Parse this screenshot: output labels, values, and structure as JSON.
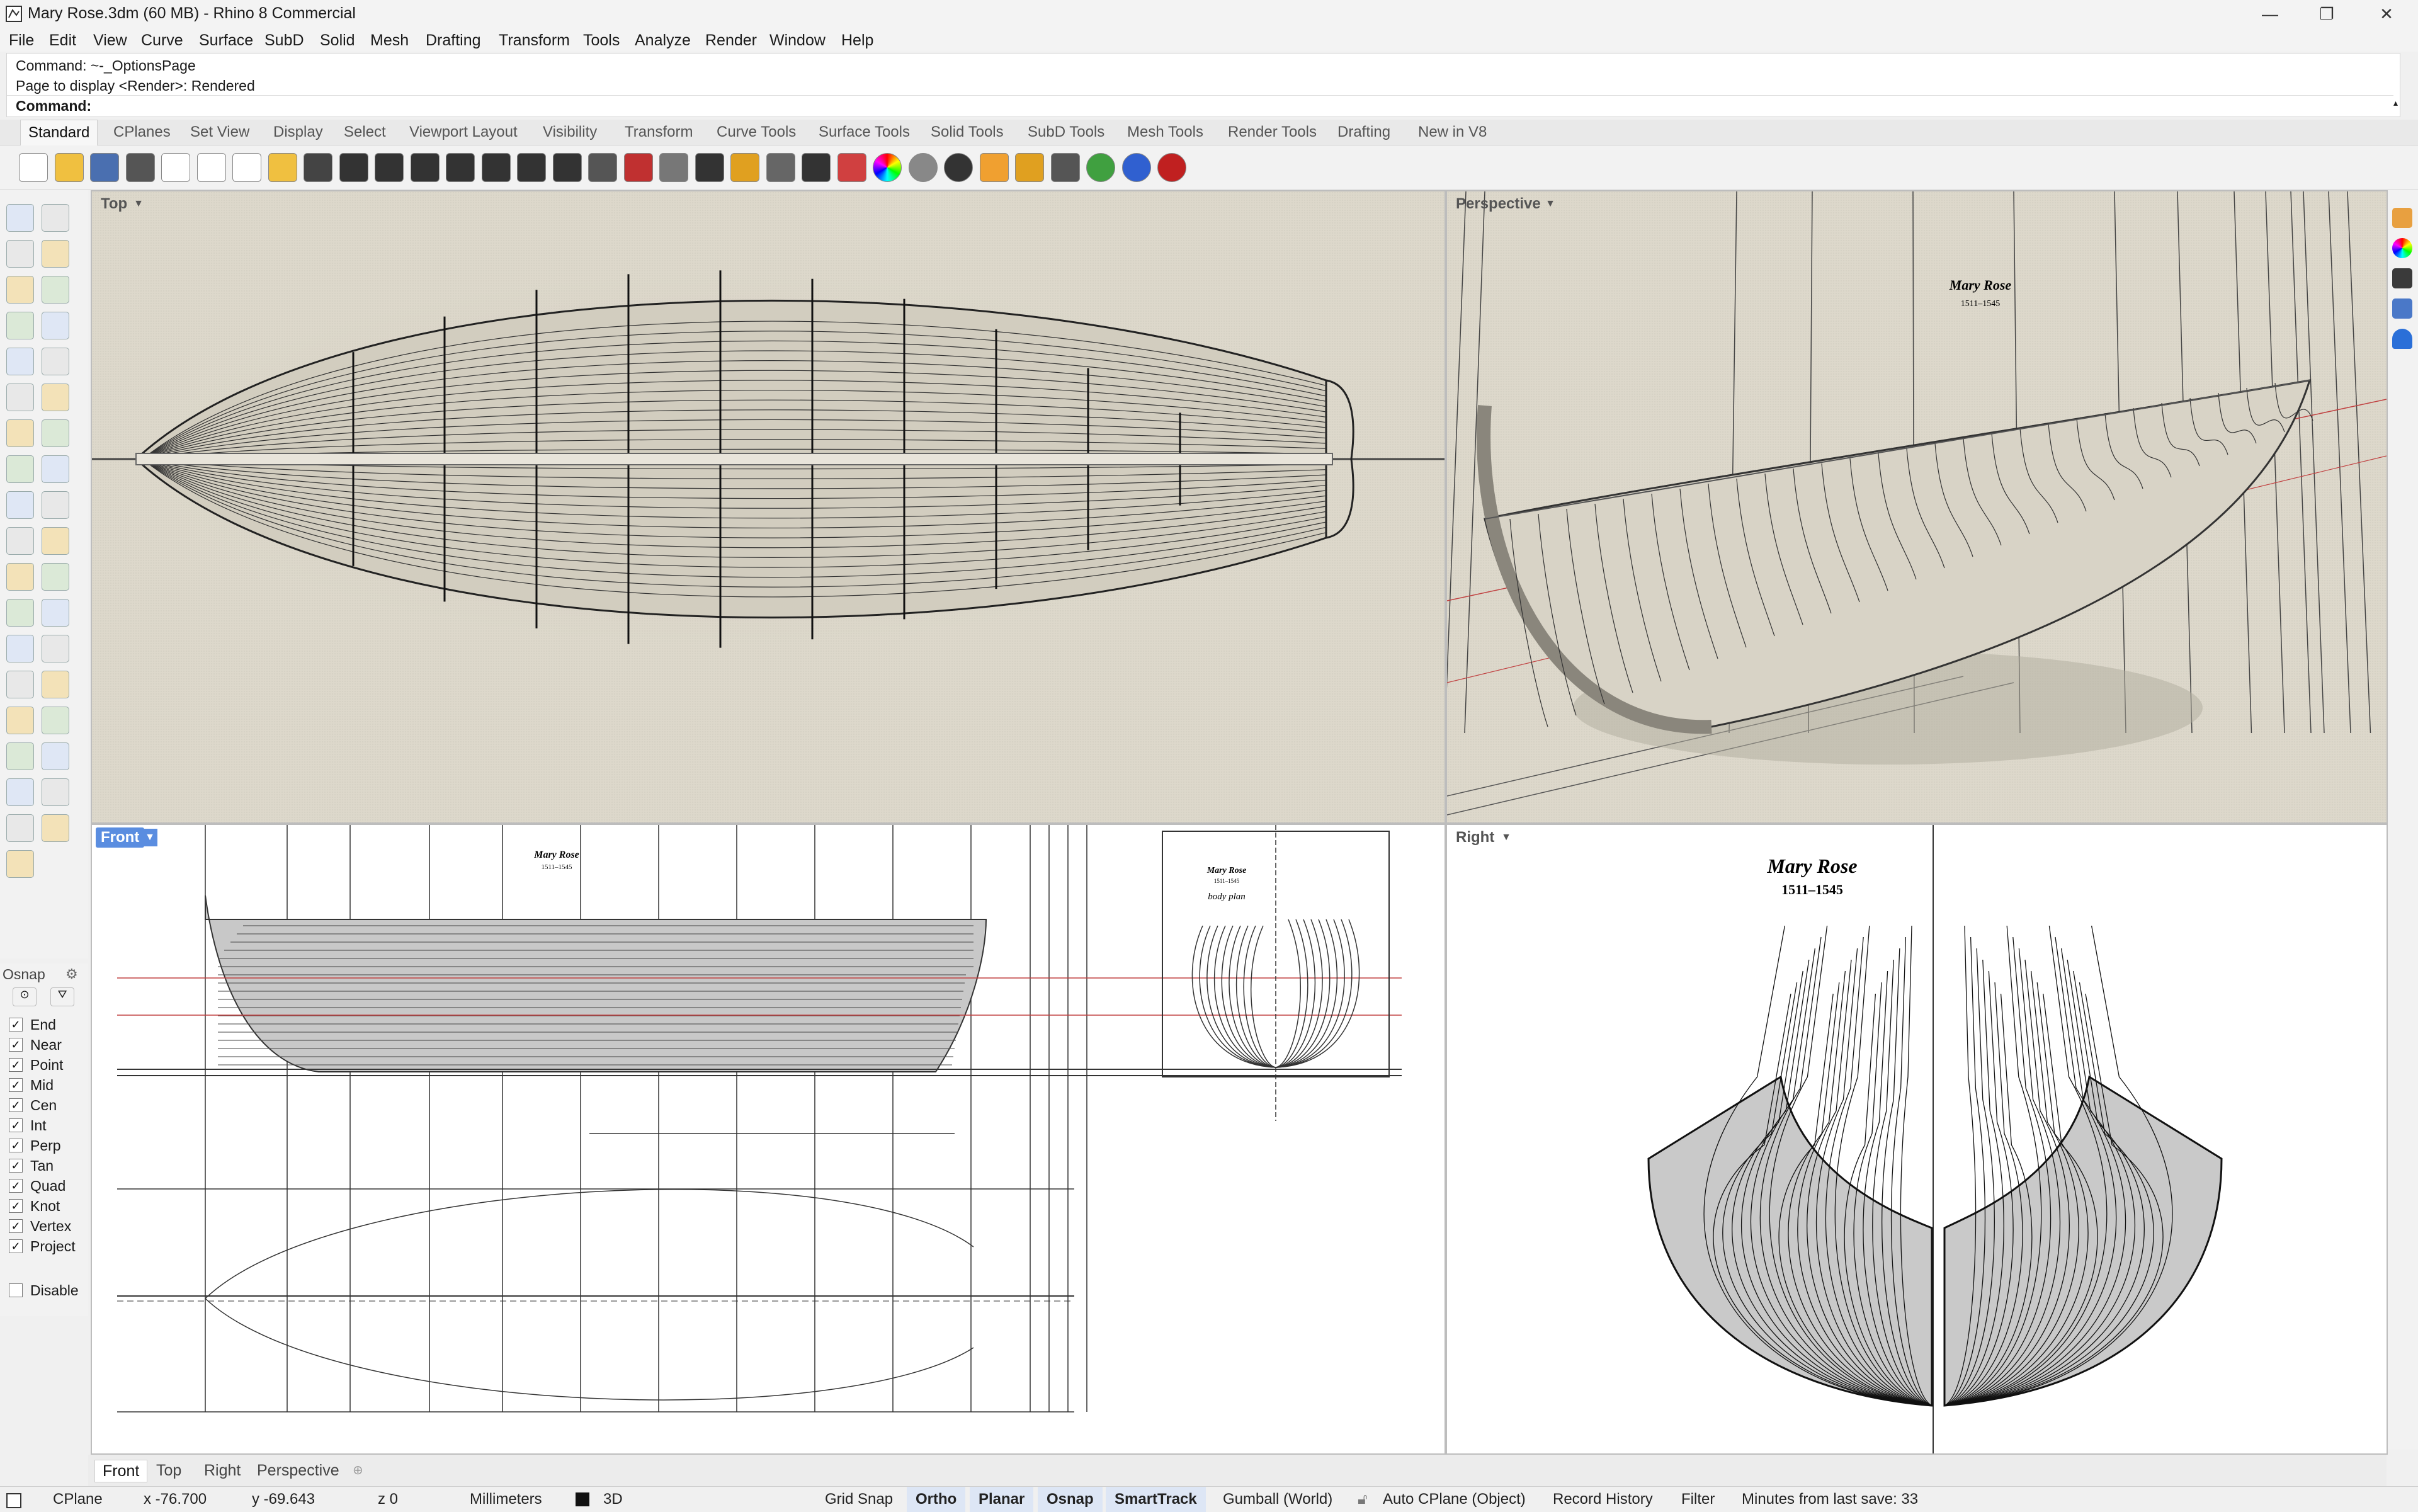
{
  "window": {
    "title": "Mary Rose.3dm (60 MB) - Rhino 8 Commercial",
    "min_btn": "—",
    "restore_btn": "❐",
    "close_btn": "✕"
  },
  "menu": [
    "File",
    "Edit",
    "View",
    "Curve",
    "Surface",
    "SubD",
    "Solid",
    "Mesh",
    "Drafting",
    "Transform",
    "Tools",
    "Analyze",
    "Render",
    "Window",
    "Help"
  ],
  "command": {
    "line1": "Command: ~-_OptionsPage",
    "line2": "Page to display <Render>: Rendered",
    "prompt": "Command:"
  },
  "toolbar_tabs": [
    "Standard",
    "CPlanes",
    "Set View",
    "Display",
    "Select",
    "Viewport Layout",
    "Visibility",
    "Transform",
    "Curve Tools",
    "Surface Tools",
    "Solid Tools",
    "SubD Tools",
    "Mesh Tools",
    "Render Tools",
    "Drafting",
    "New in V8"
  ],
  "toolbar_icons": [
    "new-file-icon",
    "open-folder-icon",
    "save-icon",
    "print-icon",
    "import-icon",
    "copy-icon",
    "paste-icon",
    "clipboard-icon",
    "undo-icon",
    "pan-hand-icon",
    "rotate-view-icon",
    "zoom-icon",
    "zoom-window-icon",
    "zoom-extents-icon",
    "zoom-selected-icon",
    "undo-view-icon",
    "grid-viewport-icon",
    "car-icon",
    "shaded-icon",
    "point-icon",
    "lights-icon",
    "bulb-icon",
    "lock-icon",
    "layers-icon",
    "color-wheel-icon",
    "sphere-icon",
    "rendered-sphere-icon",
    "flag-icon",
    "settings-gear-icon",
    "measure-icon",
    "globe-icon",
    "help-icon",
    "rhino-logo-icon"
  ],
  "viewports": {
    "top": {
      "label": "Top"
    },
    "perspective": {
      "label": "Perspective",
      "ship_name": "Mary Rose",
      "ship_years": "1511–1545"
    },
    "front": {
      "label": "Front",
      "ship_name": "Mary Rose",
      "ship_years": "1511–1545",
      "body_plan_name": "Mary Rose",
      "body_plan_years": "1511–1545",
      "body_plan_caption": "body plan"
    },
    "right": {
      "label": "Right",
      "ship_name": "Mary Rose",
      "ship_years": "1511–1545"
    }
  },
  "osnap": {
    "title": "Osnap",
    "items": [
      {
        "label": "End",
        "checked": true
      },
      {
        "label": "Near",
        "checked": true
      },
      {
        "label": "Point",
        "checked": true
      },
      {
        "label": "Mid",
        "checked": true
      },
      {
        "label": "Cen",
        "checked": true
      },
      {
        "label": "Int",
        "checked": true
      },
      {
        "label": "Perp",
        "checked": true
      },
      {
        "label": "Tan",
        "checked": true
      },
      {
        "label": "Quad",
        "checked": true
      },
      {
        "label": "Knot",
        "checked": true
      },
      {
        "label": "Vertex",
        "checked": true
      },
      {
        "label": "Project",
        "checked": true
      }
    ],
    "disable": "Disable",
    "check_mark": "✓"
  },
  "viewport_tabs": [
    "Front",
    "Top",
    "Right",
    "Perspective"
  ],
  "status": {
    "cplane": "CPlane",
    "x": "x -76.700",
    "y": "y -69.643",
    "z": "z 0",
    "units": "Millimeters",
    "layer": "3D",
    "grid_snap": "Grid Snap",
    "ortho": "Ortho",
    "planar": "Planar",
    "osnap": "Osnap",
    "smarttrack": "SmartTrack",
    "gumball": "Gumball (World)",
    "auto_cplane": "Auto CPlane (Object)",
    "record_history": "Record History",
    "filter": "Filter",
    "minutes": "Minutes from last save: 33"
  }
}
